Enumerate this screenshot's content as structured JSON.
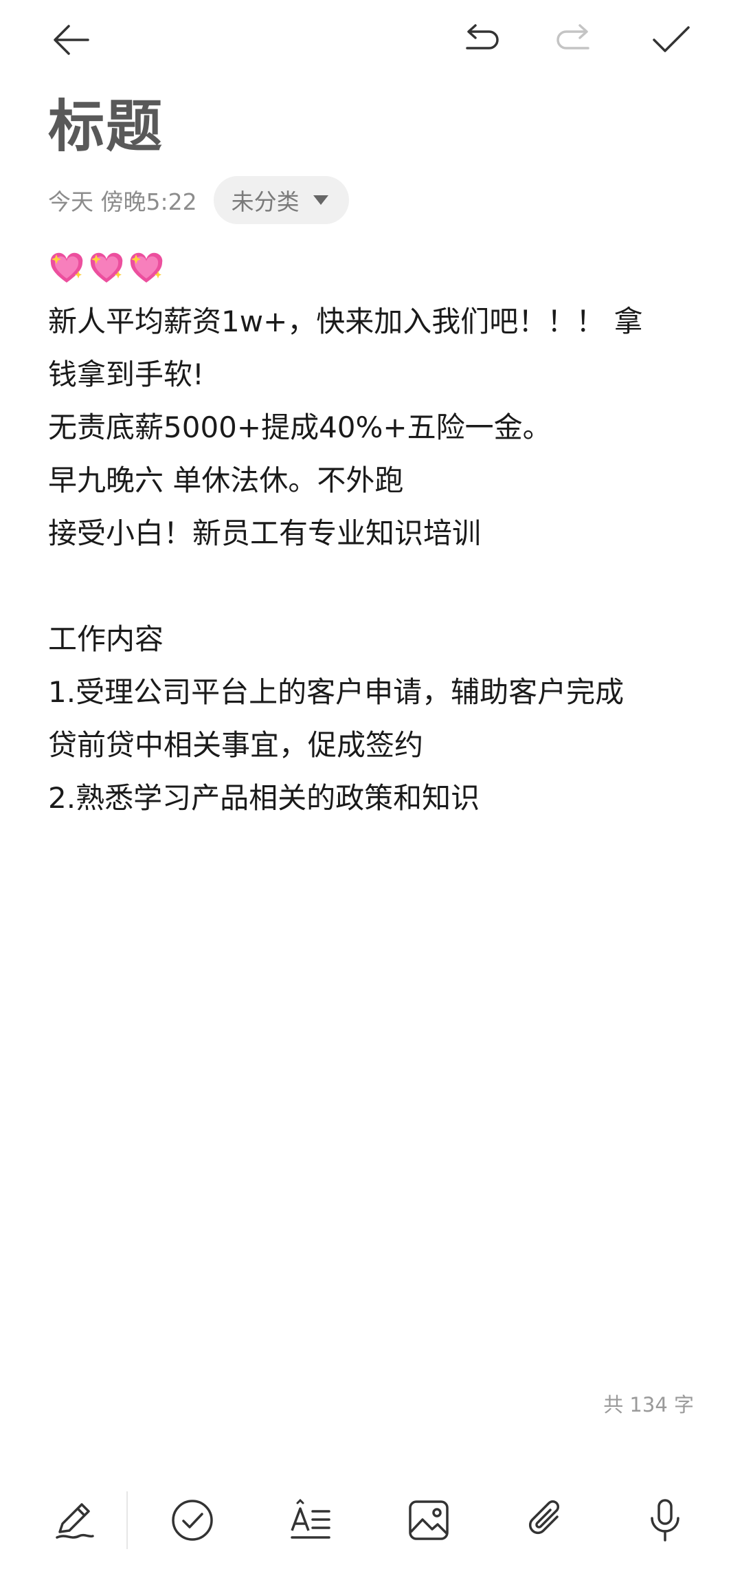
{
  "title": "标题",
  "meta": {
    "date": "今天 傍晚5:22",
    "category": "未分类"
  },
  "content": {
    "emoji": [
      "sparkling-heart",
      "sparkling-heart",
      "sparkling-heart"
    ],
    "lines": [
      "新人平均薪资1w+，快来加入我们吧！！！ 拿",
      "钱拿到手软!",
      "无责底薪5000+提成40%+五险一金。",
      "早九晚六 单休法休。不外跑",
      "接受小白！新员工有专业知识培训",
      "",
      "工作内容",
      "1.受理公司平台上的客户申请，辅助客户完成",
      "贷前贷中相关事宜，促成签约",
      "2.熟悉学习产品相关的政策和知识"
    ]
  },
  "word_count": "共 134 字",
  "toolbar_top": {
    "icons": [
      "back-arrow-icon",
      "undo-icon",
      "redo-icon",
      "checkmark-icon"
    ]
  },
  "toolbar_bottom": {
    "icons": [
      "handwriting-pen-icon",
      "checklist-icon",
      "text-format-icon",
      "image-icon",
      "attachment-icon",
      "microphone-icon"
    ]
  },
  "colors": {
    "title": "#595959",
    "text": "#1a1a1a",
    "meta": "#8c8c8c",
    "chip_bg": "#f0f0f0",
    "heart": "#e8409a"
  }
}
